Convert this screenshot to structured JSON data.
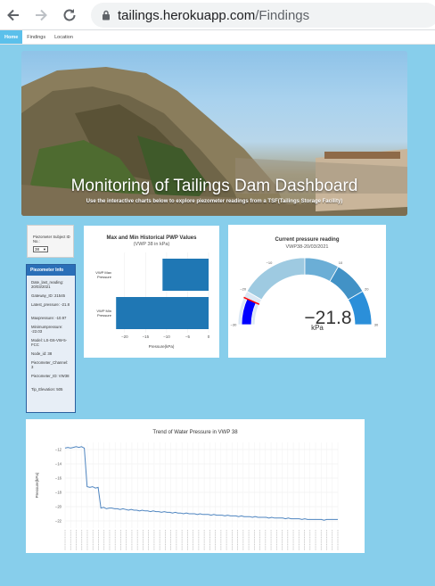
{
  "browser": {
    "url_host": "tailings.herokuapp.com",
    "url_path": "/Findings"
  },
  "nav": {
    "items": [
      "Home",
      "Findings",
      "Location"
    ]
  },
  "hero": {
    "title": "Monitoring of Tailings Dam Dashboard",
    "subtitle": "Use the interactive charts below to explore piezometer readings from a TSF(Tailings Storage Facility)"
  },
  "selector": {
    "label": "Piezometer Subject ID No.:",
    "value": "38"
  },
  "info": {
    "title": "Piezometer Info",
    "rows": [
      "Date_last_reading: 20/03/2021",
      "Gateway_ID: 21545",
      "Latest_pressure: -21.8",
      "Maxpressure: -10.97",
      "Minimumpressure: -22.03",
      "Model: LS-G6-VW-5-FCC",
      "Node_id: 38",
      "Piezometer_Channel: 3",
      "Piezometer_ID: VW38",
      "Tip_Elevation: 505"
    ]
  },
  "colors": {
    "bar": "#1f77b4",
    "gauge_value": "#0000ff",
    "gauge_steps": [
      "#dbe8f5",
      "#9ecae1",
      "#6baed6",
      "#4292c6",
      "#2b8fd9"
    ],
    "threshold": "#ff0000",
    "line": "#4f85c0"
  },
  "chart_data": [
    {
      "type": "bar",
      "orientation": "horizontal",
      "title": "Max and Min Historical PWP Values",
      "subtitle": "(VWP 38 in kPa)",
      "xlabel": "Pressure(kPa)",
      "categories": [
        "VWP Max Pressure",
        "VWP Min Pressure"
      ],
      "values": [
        -10.97,
        -22.03
      ],
      "xlim": [
        -22.5,
        0
      ],
      "xticks": [
        -20,
        -15,
        -10,
        -5,
        0
      ]
    },
    {
      "type": "gauge",
      "title": "Current pressure reading",
      "subtitle": "VWP38-20/03/2021",
      "value": -21.8,
      "display": "−21.8",
      "unit": "kPa",
      "range": [
        -30,
        30
      ],
      "ticks": [
        -30,
        -20,
        -10,
        10,
        20,
        30
      ],
      "steps": [
        [
          -30,
          -20
        ],
        [
          -20,
          0
        ],
        [
          0,
          10
        ],
        [
          10,
          20
        ],
        [
          20,
          30
        ]
      ],
      "threshold": -22
    },
    {
      "type": "line",
      "title": "Trend of Water Pressure in VWP 38",
      "ylabel": "Pressure(kPa)",
      "ylim": [
        -23,
        -11
      ],
      "yticks": [
        -12,
        -14,
        -16,
        -18,
        -20,
        -22
      ],
      "x": [
        0,
        1,
        2,
        3,
        4,
        5,
        6,
        7,
        8,
        9,
        10,
        11,
        12,
        13,
        14,
        15,
        16,
        17,
        18,
        19,
        20,
        21,
        22,
        23,
        24,
        25,
        26,
        27,
        28,
        29,
        30,
        31,
        32,
        33,
        34,
        35,
        36,
        37,
        38,
        39,
        40,
        41,
        42,
        43,
        44,
        45,
        46,
        47,
        48,
        49,
        50,
        51,
        52,
        53,
        54,
        55,
        56,
        57,
        58,
        59,
        60,
        61,
        62,
        63,
        64,
        65,
        66,
        67,
        68,
        69,
        70,
        71,
        72,
        73,
        74,
        75,
        76,
        77,
        78,
        79,
        80,
        81,
        82,
        83,
        84,
        85,
        86,
        87,
        88,
        89,
        90,
        91,
        92,
        93,
        94,
        95,
        96,
        97,
        98,
        99
      ],
      "y": [
        -11.8,
        -11.7,
        -11.8,
        -11.7,
        -11.6,
        -11.7,
        -11.6,
        -11.8,
        -17.2,
        -17.3,
        -17.2,
        -17.4,
        -17.3,
        -20.2,
        -20.1,
        -20.3,
        -20.2,
        -20.2,
        -20.3,
        -20.3,
        -20.4,
        -20.3,
        -20.4,
        -20.5,
        -20.4,
        -20.5,
        -20.5,
        -20.6,
        -20.5,
        -20.6,
        -20.6,
        -20.7,
        -20.6,
        -20.7,
        -20.7,
        -20.8,
        -20.7,
        -20.8,
        -20.8,
        -20.9,
        -20.8,
        -20.9,
        -20.9,
        -21.0,
        -20.9,
        -21.0,
        -21.0,
        -21.0,
        -21.1,
        -21.0,
        -21.1,
        -21.1,
        -21.1,
        -21.2,
        -21.1,
        -21.2,
        -21.2,
        -21.2,
        -21.3,
        -21.2,
        -21.3,
        -21.3,
        -21.3,
        -21.4,
        -21.3,
        -21.4,
        -21.4,
        -21.4,
        -21.5,
        -21.4,
        -21.5,
        -21.5,
        -21.5,
        -21.5,
        -21.6,
        -21.5,
        -21.6,
        -21.6,
        -21.6,
        -21.6,
        -21.7,
        -21.6,
        -21.7,
        -21.7,
        -21.7,
        -21.7,
        -21.8,
        -21.7,
        -21.8,
        -21.8,
        -21.8,
        -21.8,
        -21.8,
        -21.8,
        -21.9,
        -21.8,
        -21.8,
        -21.8,
        -21.8,
        -21.8
      ]
    }
  ]
}
